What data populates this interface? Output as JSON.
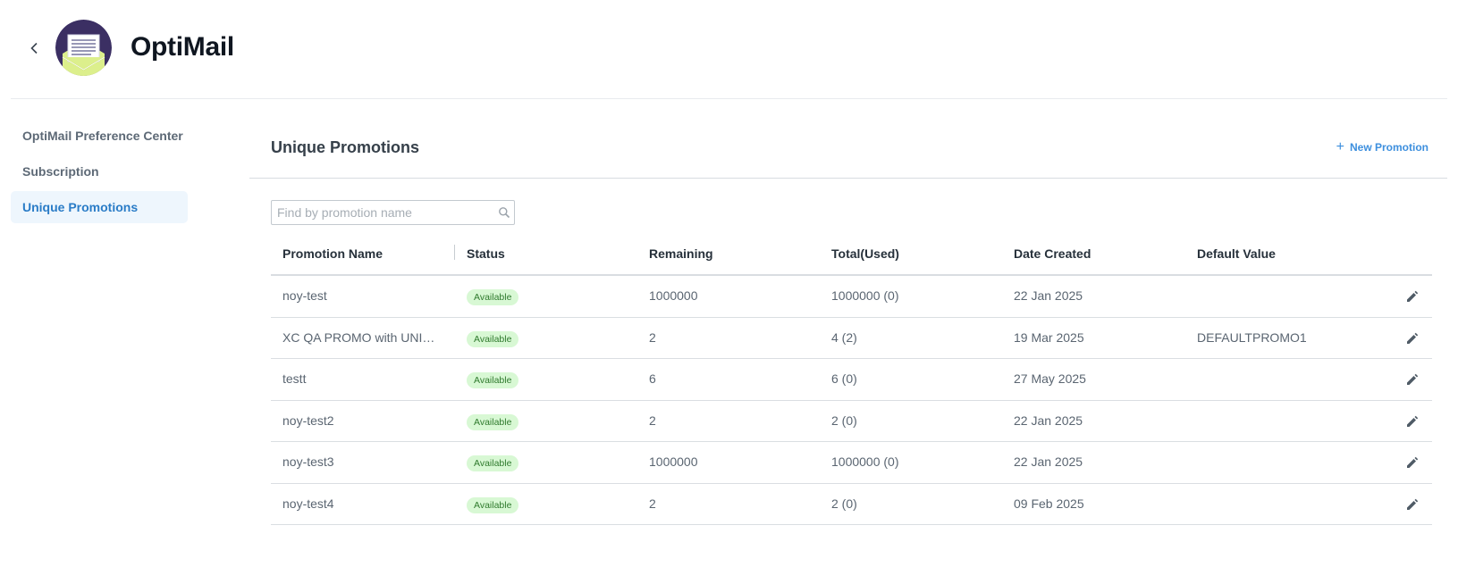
{
  "header": {
    "app_title": "OptiMail",
    "back_icon": "chevron-left-icon",
    "logo_icon": "mail-envelope-logo"
  },
  "sidebar": {
    "items": [
      {
        "label": "OptiMail Preference Center",
        "active": false
      },
      {
        "label": "Subscription",
        "active": false
      },
      {
        "label": "Unique Promotions",
        "active": true
      }
    ]
  },
  "main": {
    "title": "Unique Promotions",
    "new_button": {
      "icon": "plus-icon",
      "label": "New Promotion"
    },
    "search": {
      "placeholder": "Find by promotion name",
      "value": ""
    },
    "table": {
      "headers": [
        "Promotion Name",
        "Status",
        "Remaining",
        "Total(Used)",
        "Date Created",
        "Default Value"
      ],
      "rows": [
        {
          "name": "noy-test",
          "status": "Available",
          "remaining": "1000000",
          "total": "1000000 (0)",
          "date": "22 Jan 2025",
          "default": ""
        },
        {
          "name": "XC QA PROMO with UNIQUE CODES",
          "status": "Available",
          "remaining": "2",
          "total": "4 (2)",
          "date": "19 Mar 2025",
          "default": "DEFAULTPROMO1"
        },
        {
          "name": "testt",
          "status": "Available",
          "remaining": "6",
          "total": "6 (0)",
          "date": "27 May 2025",
          "default": ""
        },
        {
          "name": "noy-test2",
          "status": "Available",
          "remaining": "2",
          "total": "2 (0)",
          "date": "22 Jan 2025",
          "default": ""
        },
        {
          "name": "noy-test3",
          "status": "Available",
          "remaining": "1000000",
          "total": "1000000 (0)",
          "date": "22 Jan 2025",
          "default": ""
        },
        {
          "name": "noy-test4",
          "status": "Available",
          "remaining": "2",
          "total": "2 (0)",
          "date": "09 Feb 2025",
          "default": ""
        }
      ]
    }
  },
  "colors": {
    "accent": "#3d8fde",
    "active_nav_bg": "#eef6fd",
    "badge_bg": "#d8f8d4",
    "badge_text": "#2f7a2d",
    "logo_bg": "#3b2f63",
    "logo_envelope": "#dcef8c"
  }
}
